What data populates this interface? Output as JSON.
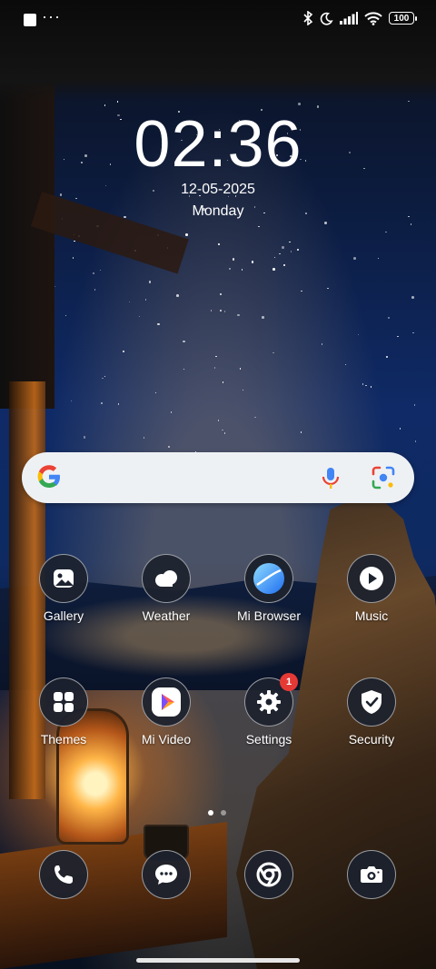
{
  "status_bar": {
    "more_dots": "···",
    "battery": "100"
  },
  "clock": {
    "time": "02:36",
    "date": "12-05-2025",
    "day": "Monday"
  },
  "search": {
    "logo_letter": "G"
  },
  "apps": [
    {
      "label": "Gallery",
      "icon": "gallery-icon"
    },
    {
      "label": "Weather",
      "icon": "weather-icon"
    },
    {
      "label": "Mi Browser",
      "icon": "browser-icon"
    },
    {
      "label": "Music",
      "icon": "music-icon"
    },
    {
      "label": "Themes",
      "icon": "themes-icon"
    },
    {
      "label": "Mi Video",
      "icon": "video-icon"
    },
    {
      "label": "Settings",
      "icon": "settings-icon",
      "badge": "1"
    },
    {
      "label": "Security",
      "icon": "security-icon"
    }
  ],
  "dock": [
    {
      "icon": "phone-icon"
    },
    {
      "icon": "messages-icon"
    },
    {
      "icon": "chrome-icon"
    },
    {
      "icon": "camera-icon"
    }
  ],
  "pager": {
    "pages": 2,
    "current": 1
  }
}
